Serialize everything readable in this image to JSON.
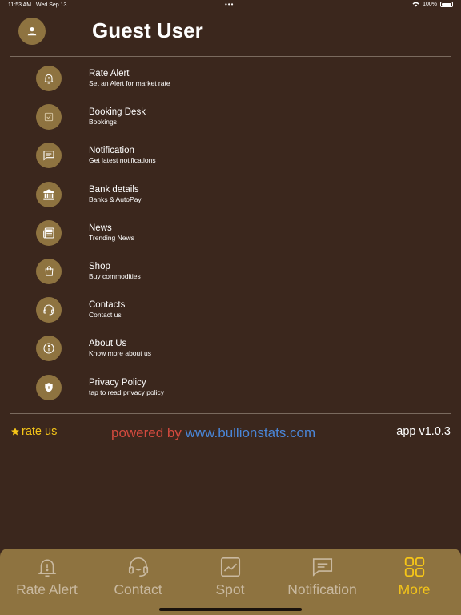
{
  "status_bar": {
    "time": "11:53 AM",
    "date": "Wed Sep 13",
    "dots": "•••",
    "battery": "100%"
  },
  "header": {
    "title": "Guest User",
    "avatar_icon": "person-icon"
  },
  "menu": {
    "items": [
      {
        "title": "Rate Alert",
        "subtitle": "Set an Alert for market rate",
        "icon": "bell-icon"
      },
      {
        "title": "Booking Desk",
        "subtitle": "Bookings",
        "icon": "checkbox-icon"
      },
      {
        "title": "Notification",
        "subtitle": "Get latest notifications",
        "icon": "message-icon"
      },
      {
        "title": "Bank details",
        "subtitle": "Banks & AutoPay",
        "icon": "bank-icon"
      },
      {
        "title": "News",
        "subtitle": "Trending News",
        "icon": "newspaper-icon"
      },
      {
        "title": "Shop",
        "subtitle": "Buy commodities",
        "icon": "shopping-bag-icon"
      },
      {
        "title": "Contacts",
        "subtitle": "Contact us",
        "icon": "headset-icon"
      },
      {
        "title": "About Us",
        "subtitle": "Know more about us",
        "icon": "info-icon"
      },
      {
        "title": "Privacy Policy",
        "subtitle": "tap to read privacy policy",
        "icon": "shield-icon"
      }
    ]
  },
  "footer": {
    "rate_us": "rate us",
    "powered_by": "powered by",
    "website": "www.bullionstats.com",
    "version": "app v1.0.3"
  },
  "tabs": [
    {
      "label": "Rate Alert",
      "icon": "bell-icon",
      "active": false
    },
    {
      "label": "Contact",
      "icon": "headset-icon",
      "active": false
    },
    {
      "label": "Spot",
      "icon": "chart-icon",
      "active": false
    },
    {
      "label": "Notification",
      "icon": "message-icon",
      "active": false
    },
    {
      "label": "More",
      "icon": "grid-icon",
      "active": true
    }
  ],
  "colors": {
    "background": "#3b271d",
    "accent": "#8e7340",
    "active_tab": "#f5c518",
    "powered_by": "#d24a3e",
    "link": "#4a86d8"
  }
}
